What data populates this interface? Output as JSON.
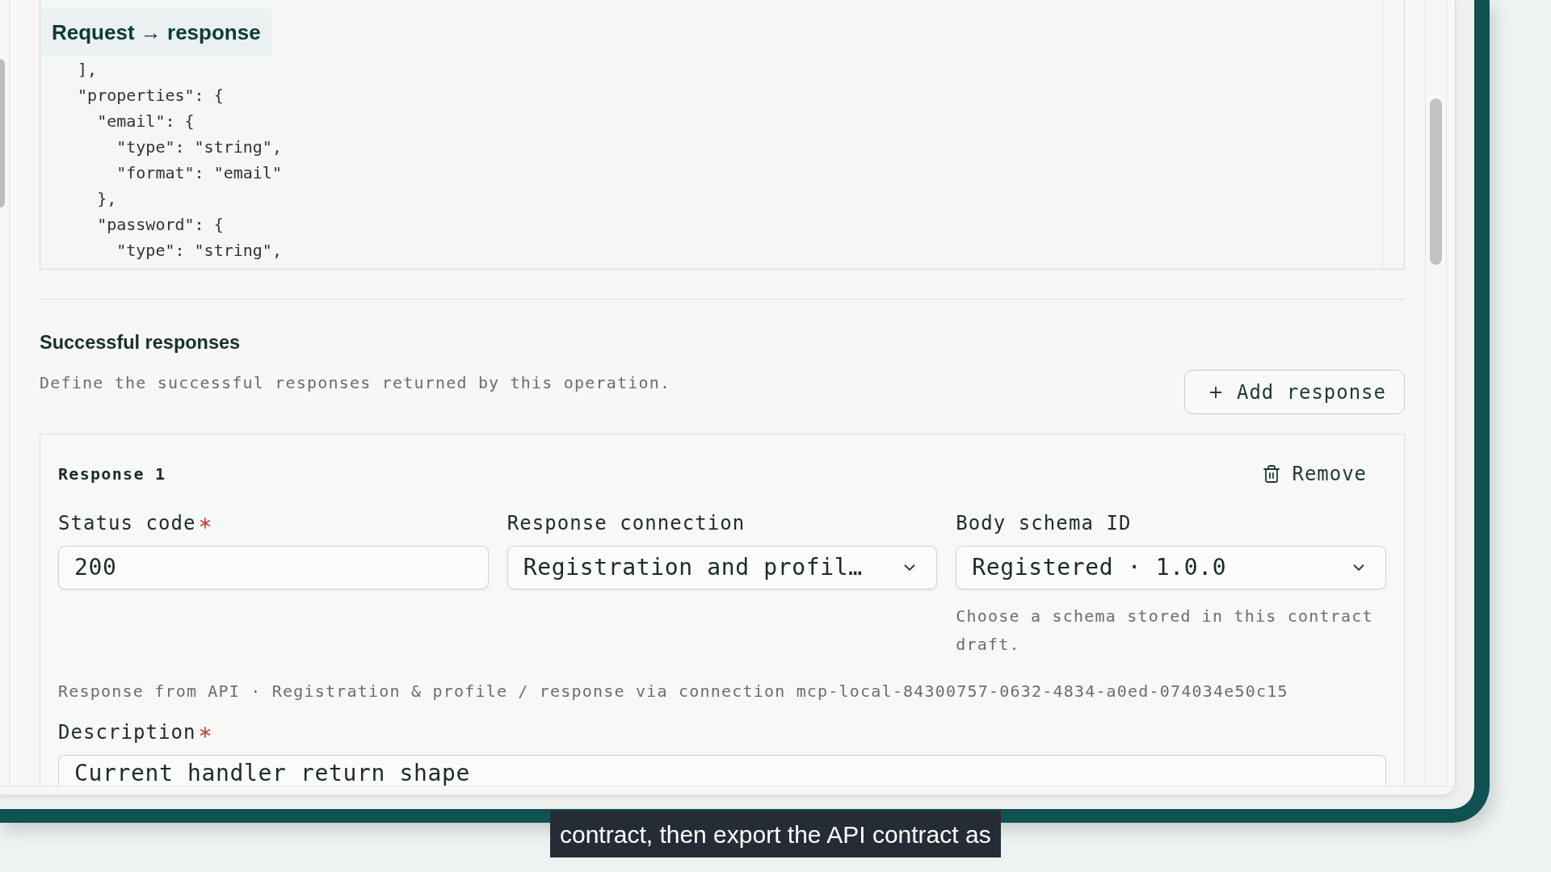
{
  "code_panel": {
    "label": "Request → response",
    "lines": [
      "  ],",
      "  \"properties\": {",
      "    \"email\": {",
      "      \"type\": \"string\",",
      "      \"format\": \"email\"",
      "    },",
      "    \"password\": {",
      "      \"type\": \"string\","
    ]
  },
  "successful_responses": {
    "title": "Successful responses",
    "description": "Define the successful responses returned by this operation.",
    "add_button": "Add response",
    "responses": [
      {
        "title": "Response 1",
        "remove_button": "Remove",
        "fields": [
          {
            "kind": "text",
            "label": "Status code",
            "required": true,
            "value": "200"
          },
          {
            "kind": "select",
            "label": "Response connection",
            "required": false,
            "value": "Registration and profil…"
          },
          {
            "kind": "select",
            "label": "Body schema ID",
            "required": false,
            "value": "Registered · 1.0.0",
            "hint": "Choose a schema stored in this contract draft."
          }
        ],
        "source_note": "Response from API · Registration & profile / response via connection mcp-local-84300757-0632-4834-a0ed-074034e50c15",
        "description": {
          "label": "Description",
          "required": true,
          "value": "Current handler return shape"
        }
      }
    ]
  },
  "caption": "contract, then export the API contract as"
}
